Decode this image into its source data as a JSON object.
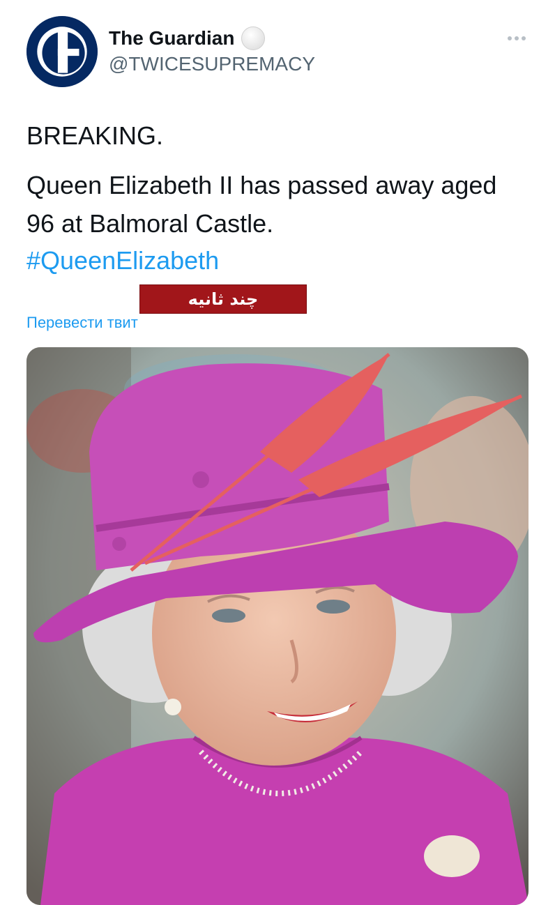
{
  "tweet": {
    "display_name": "The Guardian",
    "handle": "@TWICESUPREMACY",
    "lines": {
      "breaking": "BREAKING.",
      "body": "Queen Elizabeth II has passed away aged 96 at Balmoral Castle.",
      "hashtag": "#QueenElizabeth"
    },
    "overlay_label": "چند ثانیه",
    "translate_link": "Перевести твит"
  },
  "icons": {
    "avatar": "guardian-logo-icon",
    "verified": "verified-badge-icon",
    "more": "more-options-icon"
  },
  "colors": {
    "link": "#1d9bf0",
    "avatar_bg": "#052962",
    "overlay_bg": "#a1161a",
    "hat": "#c64fb8",
    "feather": "#e5605f"
  }
}
